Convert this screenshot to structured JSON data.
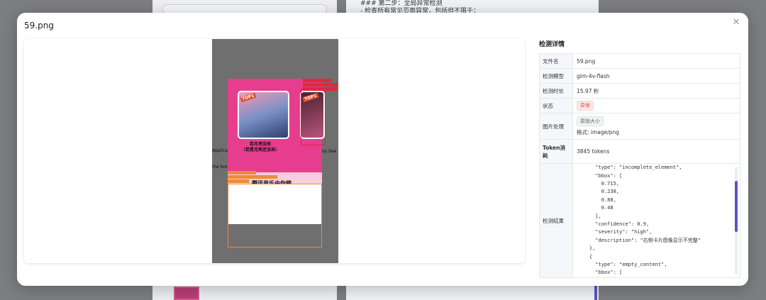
{
  "background": {
    "instructions": "### 第二步：全局异常检测\n- 检查所有常见页面异常，包括但不限于："
  },
  "modal": {
    "title": "59.png",
    "close_icon": "close-icon"
  },
  "preview": {
    "card1_badge": "TOP1",
    "card2_badge": "TOP1",
    "song_title": "若月亮没来\n（若是月亮还没来）",
    "brand": "腾讯音乐由你榜",
    "overlay_left_1": "Applica",
    "overlay_left_2": "the bro",
    "overlay_right": "by bee"
  },
  "details": {
    "title": "检测详情",
    "rows": {
      "filename_label": "文件名",
      "filename": "59.png",
      "model_label": "检测模型",
      "model": "glm-4v-flash",
      "duration_label": "检测时长",
      "duration": "15.97 秒",
      "status_label": "状态",
      "status": "异常",
      "image_label": "图片处理",
      "image_size": "原始大小",
      "image_format": "格式: image/png",
      "token_label": "Token消耗",
      "token": "3845 tokens",
      "result_label": "检测结果",
      "result_code": "      \"type\": \"incomplete_element\",\n      \"bbox\": [\n        0.715,\n        0.238,\n        0.88,\n        0.48\n      ],\n      \"confidence\": 0.9,\n      \"severity\": \"high\",\n      \"description\": \"右侧卡片图像显示不完整\"\n    },\n    {\n      \"type\": \"empty_content\",\n      \"bbox\": ["
    }
  },
  "colors": {
    "accent": "#5b55c8",
    "error": "#e5484d",
    "bbox_red": "#e1283c",
    "bbox_orange": "#f08a3a"
  }
}
